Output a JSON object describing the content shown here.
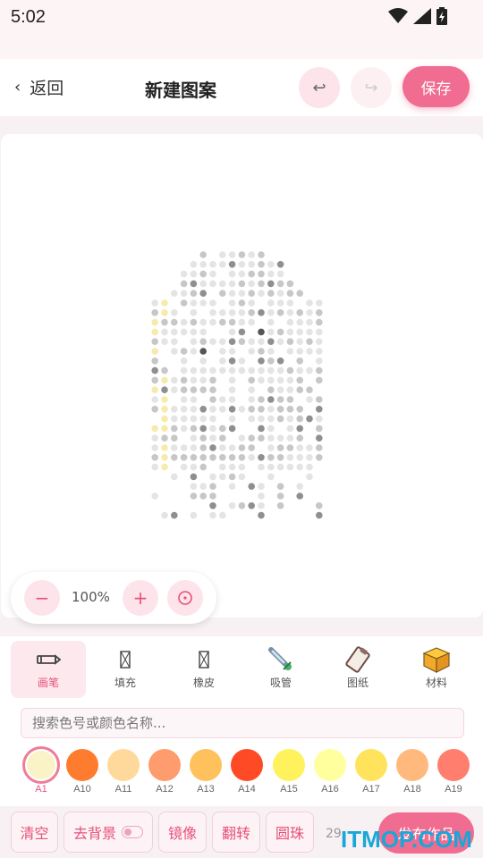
{
  "status": {
    "time": "5:02",
    "icons": [
      "wifi-icon",
      "signal-icon",
      "battery-charging-icon"
    ]
  },
  "header": {
    "back_label": "返回",
    "title": "新建图案",
    "undo_icon": "undo-icon",
    "redo_icon": "redo-icon",
    "save_label": "保存"
  },
  "canvas": {
    "zoom_value": "100%",
    "zoom_minus": "−",
    "zoom_plus": "+"
  },
  "tools": [
    {
      "label": "画笔",
      "icon": "pencil-icon"
    },
    {
      "label": "填充",
      "icon": "fill-icon"
    },
    {
      "label": "橡皮",
      "icon": "eraser-icon"
    },
    {
      "label": "吸管",
      "icon": "eyedropper-icon"
    },
    {
      "label": "图纸",
      "icon": "clipboard-icon"
    },
    {
      "label": "材料",
      "icon": "box-icon"
    }
  ],
  "search": {
    "placeholder": "搜索色号或颜色名称..."
  },
  "palette": [
    {
      "code": "A1",
      "color": "#fbf3c8",
      "selected": true
    },
    {
      "code": "A10",
      "color": "#ff7b2e"
    },
    {
      "code": "A11",
      "color": "#ffd99b"
    },
    {
      "code": "A12",
      "color": "#ff9c6e"
    },
    {
      "code": "A13",
      "color": "#ffc15c"
    },
    {
      "code": "A14",
      "color": "#ff4a26"
    },
    {
      "code": "A15",
      "color": "#fff25c"
    },
    {
      "code": "A16",
      "color": "#ffff9e"
    },
    {
      "code": "A17",
      "color": "#ffe35c"
    },
    {
      "code": "A18",
      "color": "#ffb97c"
    },
    {
      "code": "A19",
      "color": "#ff7e6e"
    }
  ],
  "actions": {
    "clear": "清空",
    "remove_bg": "去背景",
    "mirror": "镜像",
    "flip": "翻转",
    "round_bead": "圆珠",
    "count": "29",
    "publish": "发布作品"
  },
  "watermark": "ITMOP.COM",
  "bead_colors": {
    "light": "#e4e4e4",
    "mid": "#c7c7c7",
    "dark": "#8f8f8f",
    "darkest": "#555555",
    "yellow": "#f7ebac"
  }
}
